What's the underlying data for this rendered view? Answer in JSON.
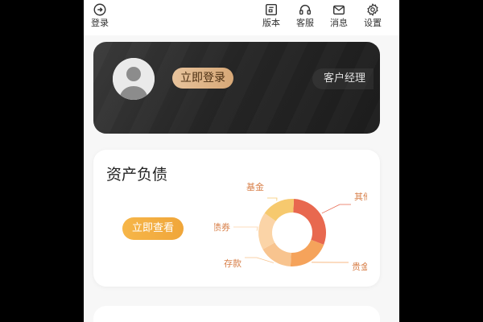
{
  "topbar": {
    "login_label": "登录",
    "version_label": "版本",
    "service_label": "客服",
    "message_label": "消息",
    "settings_label": "设置"
  },
  "user_card": {
    "login_button": "立即登录",
    "manager_button": "客户经理"
  },
  "assets": {
    "title": "资产负债",
    "view_button": "立即查看"
  },
  "chart_data": {
    "type": "pie",
    "categories": [
      "其他",
      "贵金属",
      "存款",
      "债券",
      "基金"
    ],
    "values": [
      30,
      20,
      16,
      18,
      16
    ],
    "colors": [
      "#e8684f",
      "#f5a35b",
      "#f8c48f",
      "#fbd4a7",
      "#f6c96e"
    ],
    "donut": true
  }
}
